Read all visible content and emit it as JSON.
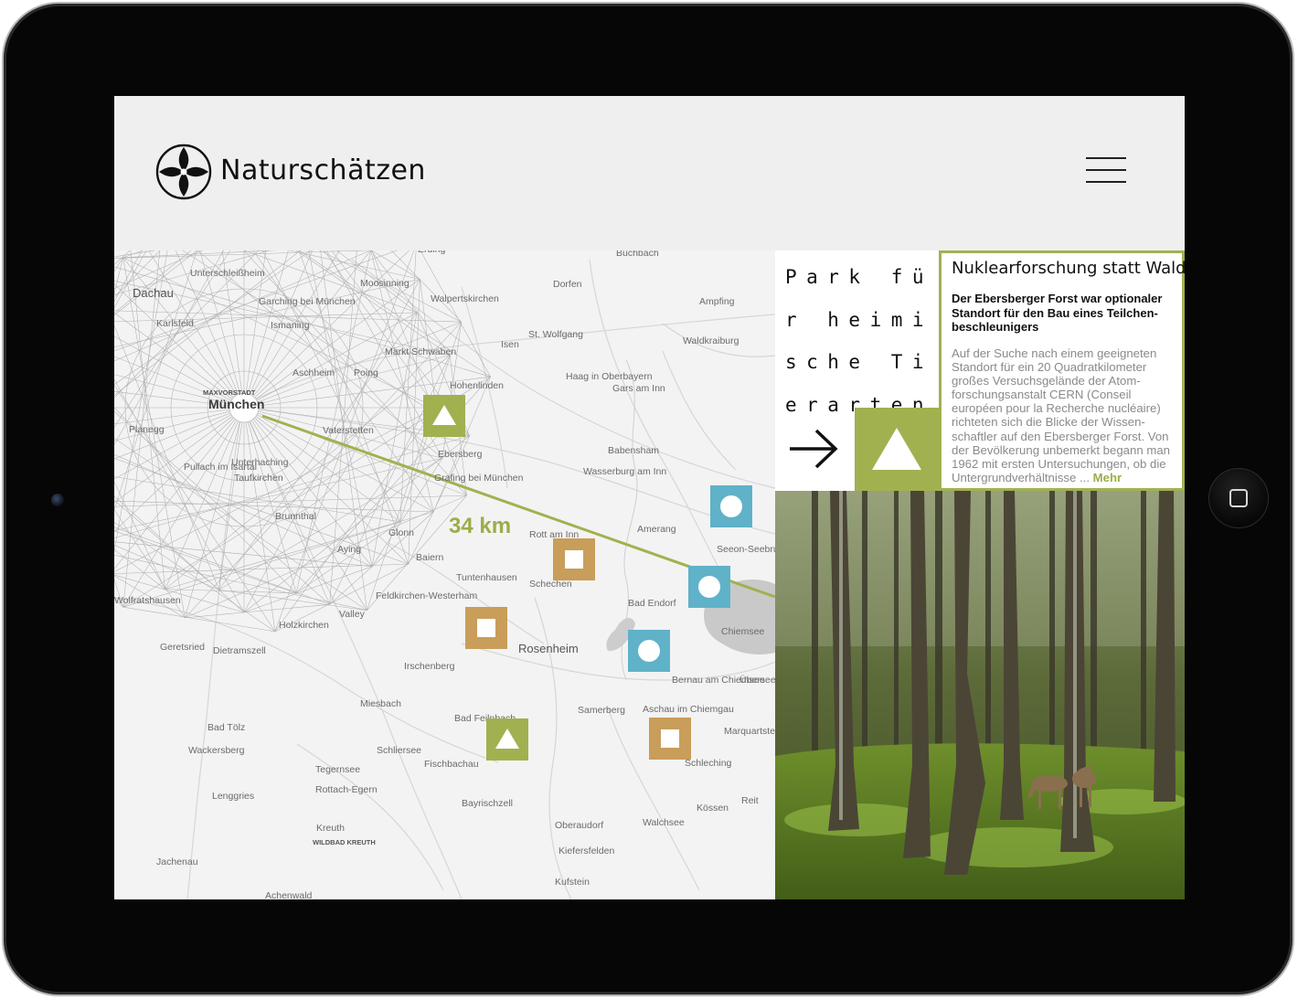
{
  "app": {
    "brand": "Naturschätzen"
  },
  "header": {
    "menu_icon": "hamburger-menu-icon"
  },
  "map": {
    "distance_label": "34 km",
    "places": [
      {
        "name": "Erding",
        "kind": "small"
      },
      {
        "name": "Unterschleißheim",
        "kind": "small"
      },
      {
        "name": "Dachau",
        "kind": "medium"
      },
      {
        "name": "Garching bei München",
        "kind": "small"
      },
      {
        "name": "Ismaning",
        "kind": "small"
      },
      {
        "name": "Karlsfeld",
        "kind": "small"
      },
      {
        "name": "Aschheim",
        "kind": "small"
      },
      {
        "name": "Poing",
        "kind": "small"
      },
      {
        "name": "Markt Schwaben",
        "kind": "small"
      },
      {
        "name": "Moosinning",
        "kind": "small"
      },
      {
        "name": "Walpertskirchen",
        "kind": "small"
      },
      {
        "name": "Dorfen",
        "kind": "small"
      },
      {
        "name": "Buchbach",
        "kind": "small"
      },
      {
        "name": "Ampfing",
        "kind": "small"
      },
      {
        "name": "St. Wolfgang",
        "kind": "small"
      },
      {
        "name": "Isen",
        "kind": "small"
      },
      {
        "name": "Waldkraiburg",
        "kind": "small"
      },
      {
        "name": "Haag in Oberbayern",
        "kind": "small"
      },
      {
        "name": "Gars am Inn",
        "kind": "small"
      },
      {
        "name": "Hohenlinden",
        "kind": "small"
      },
      {
        "name": "MAXVORSTADT",
        "kind": "tiny"
      },
      {
        "name": "München",
        "kind": "city"
      },
      {
        "name": "Vaterstetten",
        "kind": "small"
      },
      {
        "name": "Planegg",
        "kind": "small"
      },
      {
        "name": "Ebersberg",
        "kind": "small"
      },
      {
        "name": "Grafing bei München",
        "kind": "small"
      },
      {
        "name": "Babensham",
        "kind": "small"
      },
      {
        "name": "Wasserburg am Inn",
        "kind": "small"
      },
      {
        "name": "Pullach im Isartal",
        "kind": "small"
      },
      {
        "name": "Unterhaching",
        "kind": "small"
      },
      {
        "name": "Taufkirchen",
        "kind": "small"
      },
      {
        "name": "Brunnthal",
        "kind": "small"
      },
      {
        "name": "Glonn",
        "kind": "small"
      },
      {
        "name": "Rott am Inn",
        "kind": "small"
      },
      {
        "name": "Amerang",
        "kind": "small"
      },
      {
        "name": "Seeon-Seebruck",
        "kind": "small"
      },
      {
        "name": "Aying",
        "kind": "small"
      },
      {
        "name": "Baiern",
        "kind": "small"
      },
      {
        "name": "Tuntenhausen",
        "kind": "small"
      },
      {
        "name": "Schechen",
        "kind": "small"
      },
      {
        "name": "Bad Endorf",
        "kind": "small"
      },
      {
        "name": "Feldkirchen-Westerham",
        "kind": "small"
      },
      {
        "name": "Wolfratshausen",
        "kind": "small"
      },
      {
        "name": "Valley",
        "kind": "small"
      },
      {
        "name": "Holzkirchen",
        "kind": "small"
      },
      {
        "name": "Chiemsee",
        "kind": "small"
      },
      {
        "name": "Geretsried",
        "kind": "small"
      },
      {
        "name": "Dietramszell",
        "kind": "small"
      },
      {
        "name": "Rosenheim",
        "kind": "medium"
      },
      {
        "name": "Irschenberg",
        "kind": "small"
      },
      {
        "name": "Bernau am Chiemsee",
        "kind": "small"
      },
      {
        "name": "Übersee",
        "kind": "small"
      },
      {
        "name": "Miesbach",
        "kind": "small"
      },
      {
        "name": "Bad Feilnbach",
        "kind": "small"
      },
      {
        "name": "Samerberg",
        "kind": "small"
      },
      {
        "name": "Aschau im Chiemgau",
        "kind": "small"
      },
      {
        "name": "Bad Tölz",
        "kind": "small"
      },
      {
        "name": "Marquartstein",
        "kind": "small"
      },
      {
        "name": "Wackersberg",
        "kind": "small"
      },
      {
        "name": "Schliersee",
        "kind": "small"
      },
      {
        "name": "Fischbachau",
        "kind": "small"
      },
      {
        "name": "Schleching",
        "kind": "small"
      },
      {
        "name": "Tegernsee",
        "kind": "small"
      },
      {
        "name": "Rottach-Egern",
        "kind": "small"
      },
      {
        "name": "Lenggries",
        "kind": "small"
      },
      {
        "name": "Bayrischzell",
        "kind": "small"
      },
      {
        "name": "Reit",
        "kind": "small"
      },
      {
        "name": "Kössen",
        "kind": "small"
      },
      {
        "name": "Oberaudorf",
        "kind": "small"
      },
      {
        "name": "Walchsee",
        "kind": "small"
      },
      {
        "name": "Kreuth",
        "kind": "small"
      },
      {
        "name": "WILDBAD KREUTH",
        "kind": "tiny"
      },
      {
        "name": "Kiefersfelden",
        "kind": "small"
      },
      {
        "name": "Jachenau",
        "kind": "small"
      },
      {
        "name": "Kufstein",
        "kind": "small"
      },
      {
        "name": "Achenwald",
        "kind": "small"
      }
    ],
    "markers": [
      {
        "type": "triangle",
        "color": "#a1b150"
      },
      {
        "type": "circle",
        "color": "#5fb2c8"
      },
      {
        "type": "square",
        "color": "#c99d5a"
      },
      {
        "type": "circle",
        "color": "#5fb2c8"
      },
      {
        "type": "square",
        "color": "#c99d5a"
      },
      {
        "type": "circle",
        "color": "#5fb2c8"
      },
      {
        "type": "triangle",
        "color": "#a1b150"
      },
      {
        "type": "square",
        "color": "#c99d5a"
      }
    ]
  },
  "feature": {
    "kicker": "Park für heimische Tierarten",
    "arrow_icon": "arrow-right-icon",
    "category_icon": "triangle-icon",
    "accent": "#a1b150"
  },
  "article": {
    "title": "Nuklearforschung statt Wald",
    "lead": "Der Ebersberger Forst war optionaler Standort für den Bau eines Teilchen-beschleunigers",
    "body": "Auf der Suche nach einem geeigneten Standort für ein 20 Quadratkilometer großes Versuchsgelände der Atom-forschungsanstalt CERN (Conseil européen pour la Recherche nucléaire) richteten sich die Blicke der Wissen-schaftler auf den Ebersberger Forst. Von der Bevölkerung unbemerkt begann man 1962 mit ersten Untersuchungen, ob die Untergrundverhältnisse ... ",
    "more_label": "Mehr"
  },
  "colors": {
    "green": "#a1b150",
    "blue": "#5fb2c8",
    "brown": "#c99d5a"
  }
}
